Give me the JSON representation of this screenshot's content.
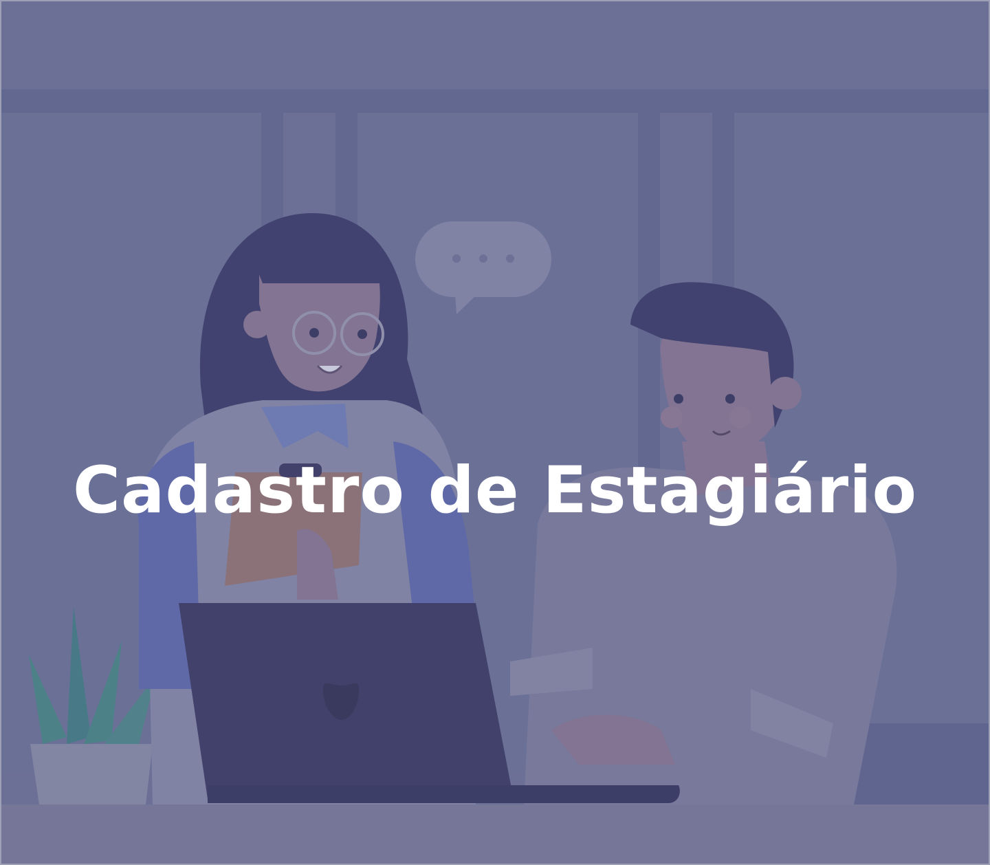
{
  "banner": {
    "title": "Cadastro de Estagiário"
  },
  "illustration": {
    "scene": "two-people-at-laptop",
    "icons": [
      "speech-bubble-icon",
      "laptop-logo-icon",
      "plant-icon"
    ]
  },
  "colors": {
    "background": "#7d81a0",
    "overlay": "#464a82",
    "title": "#ffffff",
    "dark_navy": "#3f3e62"
  }
}
